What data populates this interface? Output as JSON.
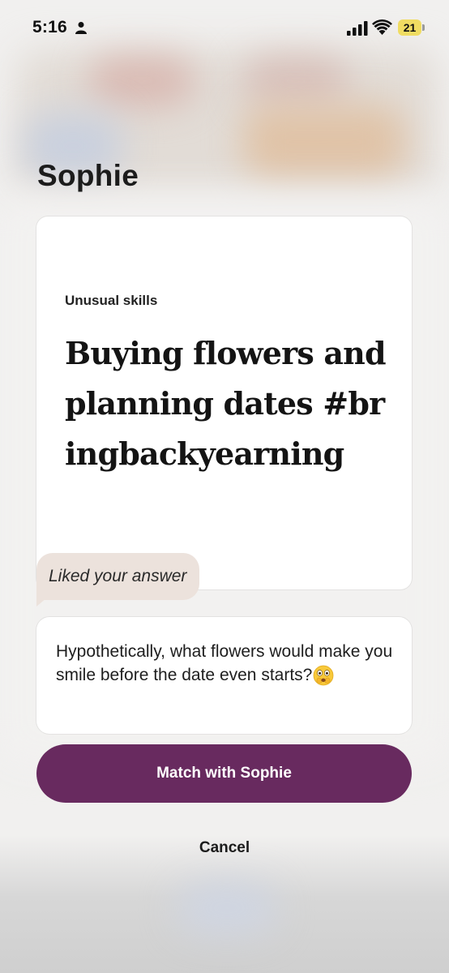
{
  "status_bar": {
    "time": "5:16",
    "battery_level": "21",
    "icons": [
      "person-icon",
      "cellular-signal-icon",
      "wifi-icon",
      "battery-icon"
    ]
  },
  "profile": {
    "name": "Sophie"
  },
  "prompt": {
    "label": "Unusual skills",
    "answer": "Buying flowers and planning dates #bringbackyearning"
  },
  "like": {
    "label": "Liked your answer"
  },
  "comment": {
    "text": "Hypothetically, what flowers would make you smile before the date even starts?",
    "emoji": "flushed-face-hands-over-mouth-emoji"
  },
  "actions": {
    "match_label": "Match with Sophie",
    "cancel_label": "Cancel"
  },
  "colors": {
    "accent": "#682a5f",
    "liked_bubble": "#ece2dc",
    "battery": "#f0dc62"
  }
}
